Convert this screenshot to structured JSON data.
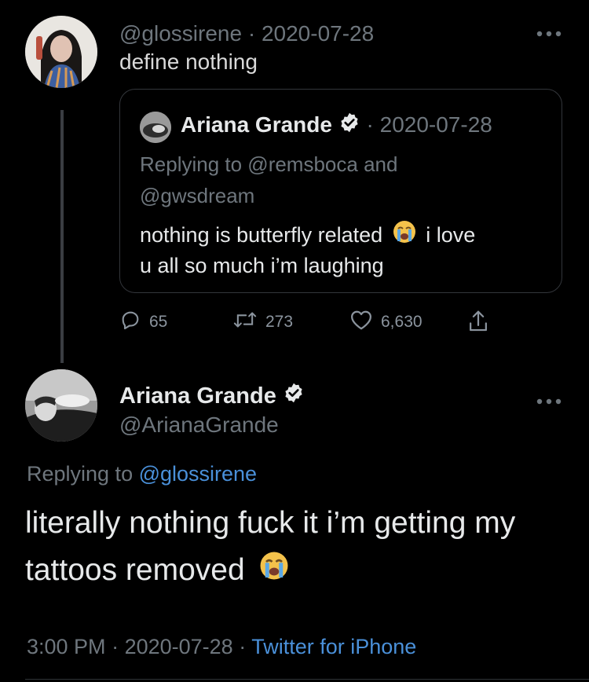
{
  "quote_tweet": {
    "handle": "@glossirene",
    "separator": " · ",
    "date": "2020-07-28",
    "text": "define nothing",
    "more_icon": "more-horizontal-icon"
  },
  "quoted": {
    "name": "Ariana Grande",
    "separator": " · ",
    "date": "2020-07-28",
    "replying_line1": "Replying to @remsboca and",
    "replying_line2": "@gwsdream",
    "text_line1_pre": "nothing is butterfly related",
    "text_line1_post": "i love",
    "text_line2": "u all so much i’m laughing"
  },
  "actions": {
    "reply_count": "65",
    "retweet_count": "273",
    "like_count": "6,630"
  },
  "main_tweet": {
    "name": "Ariana Grande",
    "handle": "@ArianaGrande",
    "replying_prefix": "Replying to ",
    "replying_handle": "@glossirene",
    "text_line1": "literally nothing fuck it i’m getting my",
    "text_line2": "tattoos removed",
    "time": "3:00 PM",
    "sep1": " · ",
    "date": "2020-07-28",
    "sep2": " · ",
    "source": "Twitter for iPhone"
  },
  "colors": {
    "background": "#000000",
    "text": "#d9d9d9",
    "muted": "#6e767d",
    "link": "#4a90d9",
    "thread_line": "#3a3d42"
  }
}
